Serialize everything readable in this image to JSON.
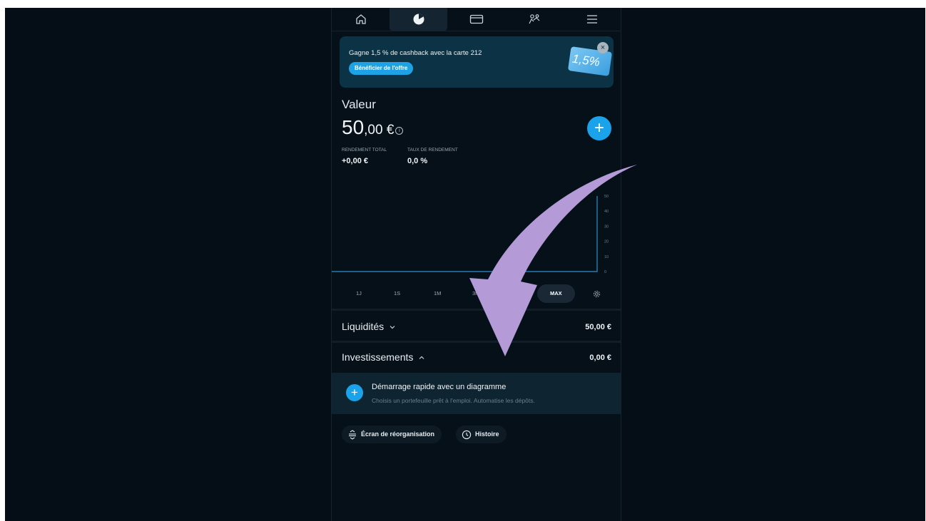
{
  "nav": {
    "tabs": [
      "home-icon",
      "portfolio-icon",
      "card-icon",
      "social-icon",
      "menu-icon"
    ]
  },
  "promo": {
    "text": "Gagne 1,5 % de cashback avec la carte 212",
    "button_label": "Bénéficier de l'offre",
    "card_text": "1,5%",
    "close_symbol": "×"
  },
  "value": {
    "label": "Valeur",
    "amount_int": "50",
    "amount_dec": ",00 €",
    "info_symbol": "i",
    "add_symbol": "+"
  },
  "stats": {
    "return_label": "RENDEMENT TOTAL",
    "return_value": "+0,00 €",
    "rate_label": "TAUX DE RENDEMENT",
    "rate_value": "0,0 %"
  },
  "chart_data": {
    "type": "line",
    "y_ticks": [
      "50",
      "40",
      "30",
      "20",
      "10",
      "0"
    ],
    "ylim": [
      0,
      50
    ],
    "values": [
      0,
      0,
      0,
      0,
      0,
      0,
      0,
      0,
      0,
      50
    ],
    "color": "#2a8fd4"
  },
  "timeframes": {
    "items": [
      "1J",
      "1S",
      "1M",
      "3M",
      "MAX"
    ],
    "active": "MAX"
  },
  "liquidites": {
    "label": "Liquidités",
    "value": "50,00 €"
  },
  "investissements": {
    "label": "Investissements",
    "value": "0,00 €"
  },
  "quickstart": {
    "title": "Démarrage rapide avec un diagramme",
    "subtitle": "Choisis un portefeuille prêt à l'emploi. Automatise les dépôts.",
    "plus_symbol": "+"
  },
  "actions": {
    "reorg_label": "Écran de réorganisation",
    "history_label": "Histoire"
  },
  "annotation_arrow_color": "#b49ad6"
}
